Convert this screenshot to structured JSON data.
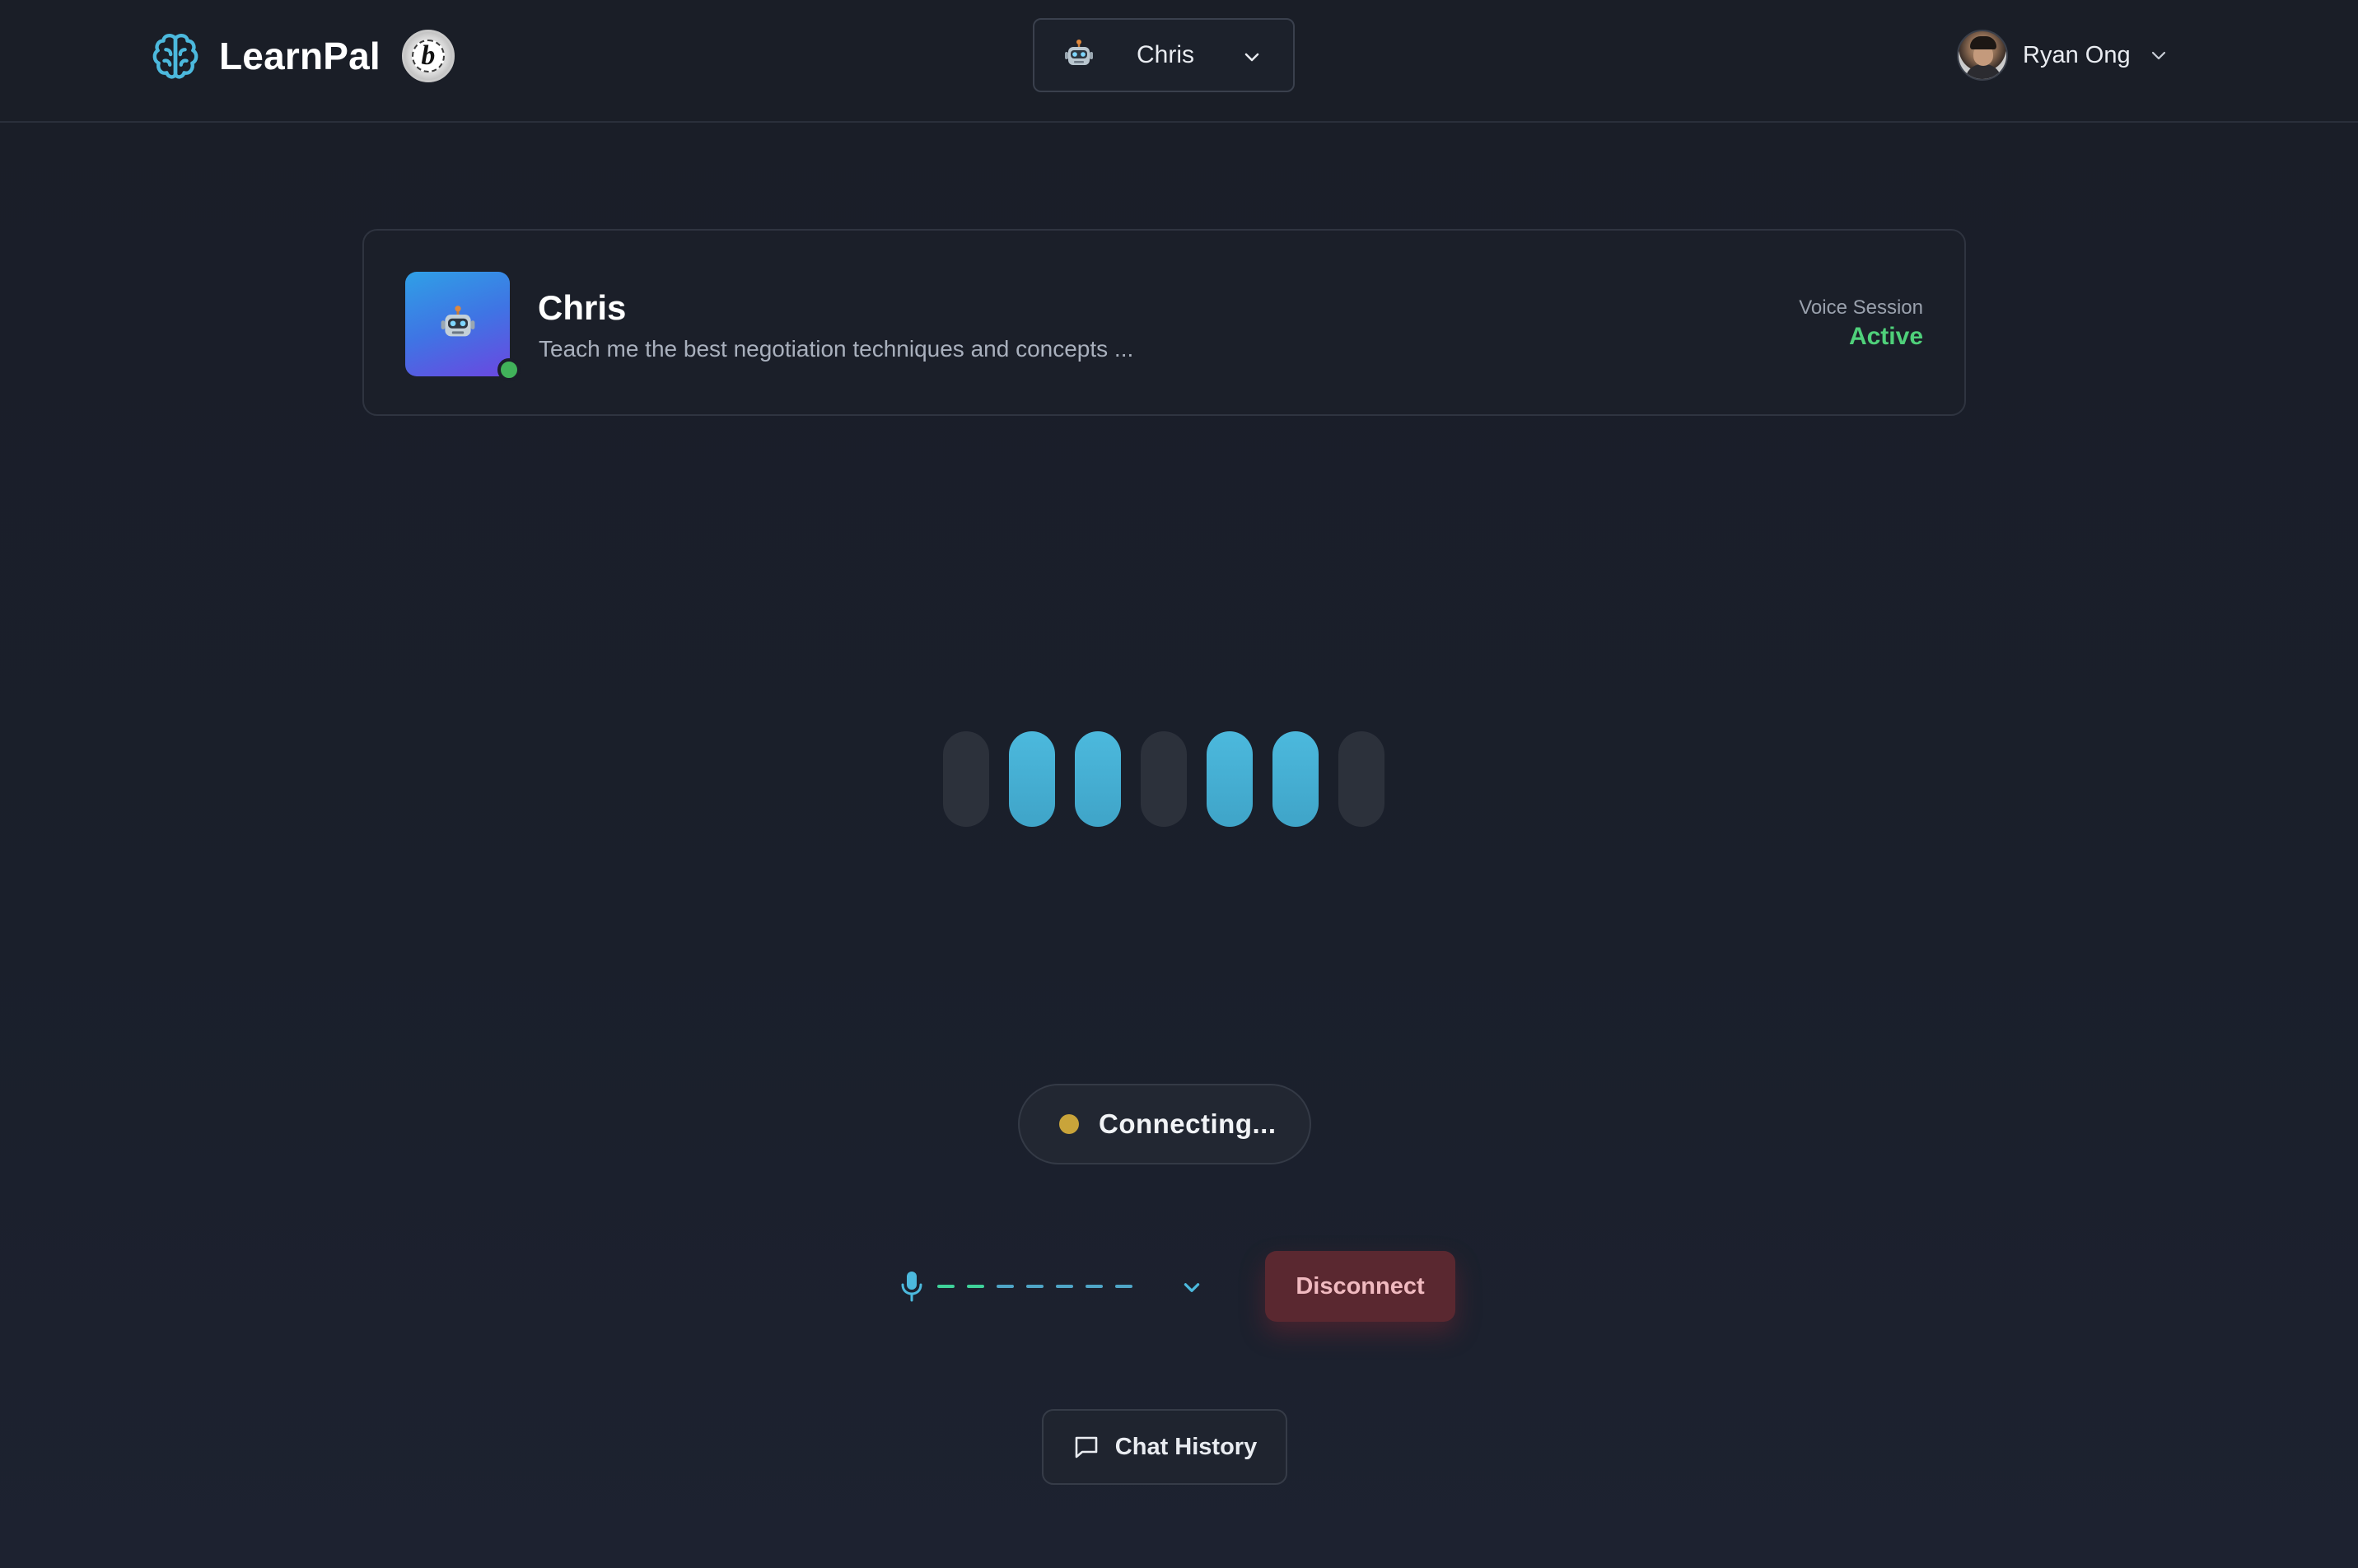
{
  "header": {
    "brand_name": "LearnPal",
    "brand_badge_letter": "b",
    "agent_selector": {
      "selected": "Chris",
      "icon": "robot-icon"
    },
    "user": {
      "name": "Ryan Ong",
      "icon": "chevron-down-icon"
    }
  },
  "agent_card": {
    "name": "Chris",
    "description": "Teach me the best negotiation techniques and concepts ...",
    "online": true,
    "session_label": "Voice Session",
    "session_status": "Active"
  },
  "visualizer": {
    "bars": [
      "off",
      "on",
      "on",
      "off",
      "on",
      "on",
      "off"
    ]
  },
  "connection": {
    "status_text": "Connecting...",
    "status_color": "#c9a43a"
  },
  "controls": {
    "mic_level_segments": [
      "active",
      "active",
      "idle",
      "idle",
      "idle",
      "idle",
      "idle"
    ],
    "disconnect_label": "Disconnect",
    "chat_history_label": "Chat History"
  },
  "colors": {
    "accent": "#4cb9dd",
    "active_green": "#4fd07a",
    "disconnect_bg": "#5a2830",
    "background": "#1a1e28"
  }
}
